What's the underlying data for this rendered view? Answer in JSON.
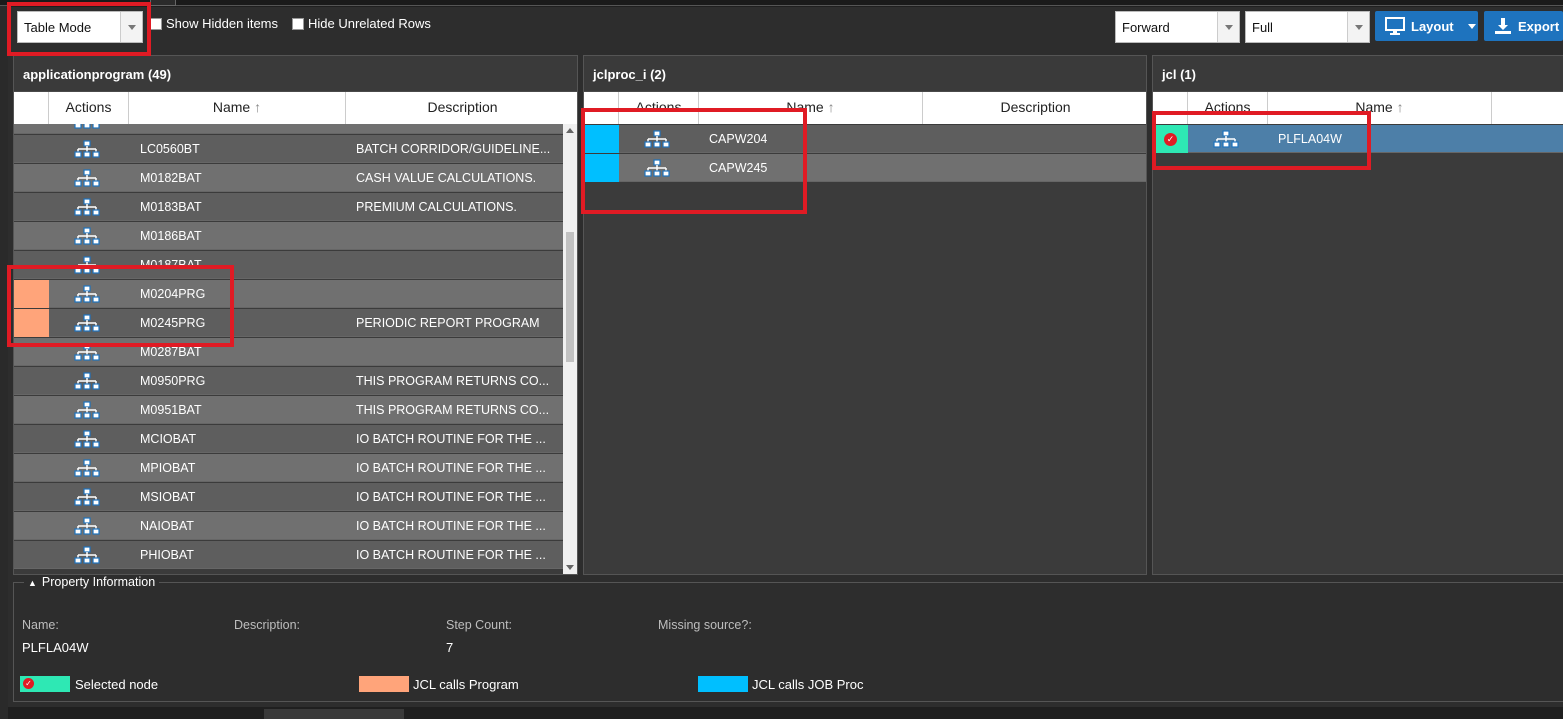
{
  "toolbar": {
    "mode_value": "Table Mode",
    "show_hidden_label": "Show Hidden items",
    "hide_unrelated_label": "Hide Unrelated Rows",
    "direction_value": "Forward",
    "scope_value": "Full",
    "layout_label": "Layout",
    "export_label": "Export"
  },
  "panels": {
    "applicationprogram": {
      "title": "applicationprogram (49)",
      "columns": {
        "actions": "Actions",
        "name": "Name",
        "description": "Description"
      },
      "rows": [
        {
          "name": "LC0560BT",
          "description": "BATCH CORRIDOR/GUIDELINE...",
          "marker": ""
        },
        {
          "name": "M0182BAT",
          "description": "CASH VALUE CALCULATIONS.",
          "marker": ""
        },
        {
          "name": "M0183BAT",
          "description": "PREMIUM CALCULATIONS.",
          "marker": ""
        },
        {
          "name": "M0186BAT",
          "description": "",
          "marker": ""
        },
        {
          "name": "M0187BAT",
          "description": "",
          "marker": ""
        },
        {
          "name": "M0204PRG",
          "description": "",
          "marker": "program"
        },
        {
          "name": "M0245PRG",
          "description": "PERIODIC REPORT PROGRAM",
          "marker": "program"
        },
        {
          "name": "M0287BAT",
          "description": "",
          "marker": ""
        },
        {
          "name": "M0950PRG",
          "description": "THIS PROGRAM RETURNS CO...",
          "marker": ""
        },
        {
          "name": "M0951BAT",
          "description": "THIS PROGRAM RETURNS CO...",
          "marker": ""
        },
        {
          "name": "MCIOBAT",
          "description": "IO BATCH ROUTINE FOR THE ...",
          "marker": ""
        },
        {
          "name": "MPIOBAT",
          "description": "IO BATCH ROUTINE FOR THE ...",
          "marker": ""
        },
        {
          "name": "MSIOBAT",
          "description": "IO BATCH ROUTINE FOR THE ...",
          "marker": ""
        },
        {
          "name": "NAIOBAT",
          "description": "IO BATCH ROUTINE FOR THE ...",
          "marker": ""
        },
        {
          "name": "PHIOBAT",
          "description": "IO BATCH ROUTINE FOR THE ...",
          "marker": ""
        }
      ]
    },
    "jclproc": {
      "title": "jclproc_i (2)",
      "columns": {
        "actions": "Actions",
        "name": "Name",
        "description": "Description"
      },
      "rows": [
        {
          "name": "CAPW204",
          "description": "",
          "marker": "jobproc"
        },
        {
          "name": "CAPW245",
          "description": "",
          "marker": "jobproc"
        }
      ]
    },
    "jcl": {
      "title": "jcl (1)",
      "columns": {
        "actions": "Actions",
        "name": "Name"
      },
      "rows": [
        {
          "name": "PLFLA04W",
          "marker": "selected"
        }
      ]
    }
  },
  "properties": {
    "section_title": "Property Information",
    "name_label": "Name:",
    "name_value": "PLFLA04W",
    "description_label": "Description:",
    "step_count_label": "Step Count:",
    "step_count_value": "7",
    "missing_source_label": "Missing source?:"
  },
  "legend": {
    "selected_node": "Selected node",
    "jcl_calls_program": "JCL calls Program",
    "jcl_calls_job_proc": "JCL calls JOB Proc"
  },
  "colors": {
    "selected": "#2ee8b4",
    "program": "#ffa47a",
    "jobproc": "#00bfff",
    "accent": "#1e73be",
    "highlight": "#e01b24"
  },
  "icons": {
    "hierarchy": "hierarchy-icon",
    "sort": "sort-up-arrow-icon",
    "check": "check-circle-icon"
  }
}
